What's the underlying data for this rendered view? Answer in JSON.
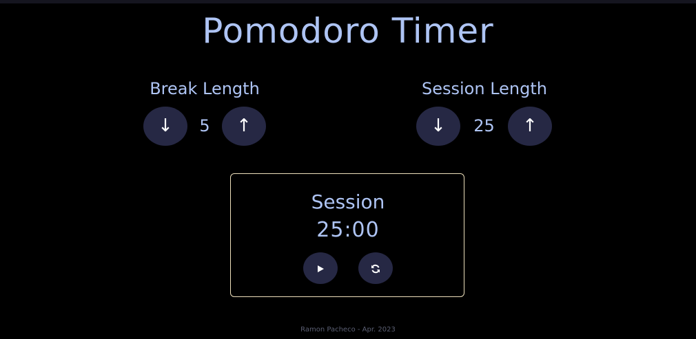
{
  "app": {
    "title": "Pomodoro Timer"
  },
  "break": {
    "label": "Break Length",
    "value": "5",
    "decrement_label": "↓",
    "increment_label": "↑"
  },
  "session": {
    "label": "Session Length",
    "value": "25",
    "decrement_label": "↓",
    "increment_label": "↑"
  },
  "timer": {
    "label": "Session",
    "time": "25:00",
    "play_icon": "play-icon",
    "reset_icon": "refresh-icon"
  },
  "footer": {
    "text": "Ramon Pacheco - Apr. 2023"
  },
  "colors": {
    "background": "#000000",
    "accent_text": "#aec4f4",
    "button_bg": "#262844",
    "timer_border": "#efe1bd",
    "footer_text": "#5b5f73"
  }
}
